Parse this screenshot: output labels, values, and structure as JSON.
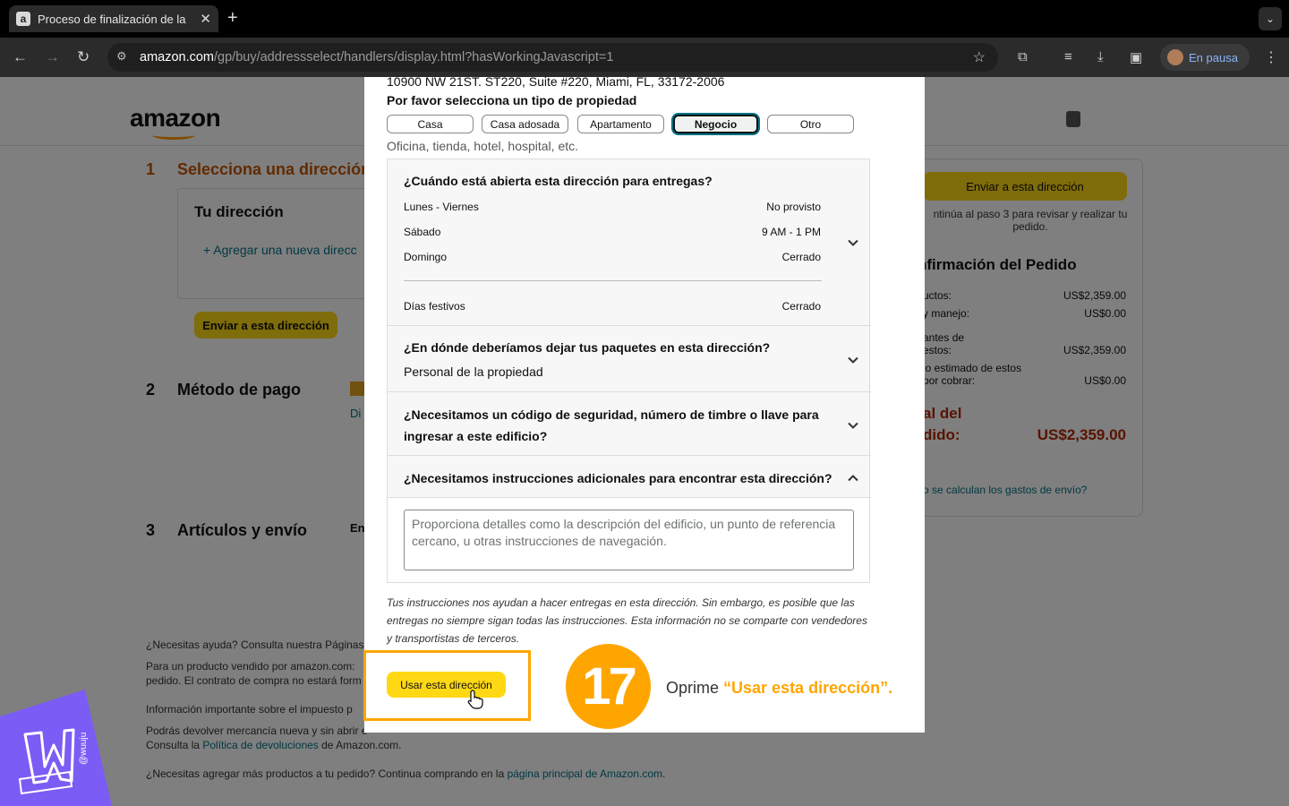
{
  "browser": {
    "tab_title": "Proceso de finalización de la",
    "favicon_letter": "a",
    "url_domain": "amazon.com",
    "url_path": "/gp/buy/addressselect/handlers/display.html?hasWorkingJavascript=1",
    "profile_label": "En pausa"
  },
  "page": {
    "logo": "amazon",
    "step1_num": "1",
    "step1_title": "Selecciona una dirección",
    "your_address": "Tu dirección",
    "add_address": "+ Agregar una nueva direcc",
    "ship_here": "Enviar a esta dirección",
    "step2_num": "2",
    "step2_title": "Método de pago",
    "step2_link": "Di",
    "step3_num": "3",
    "step3_title": "Artículos y envío",
    "step3_text": "En",
    "summary": {
      "ship_button": "Enviar a esta dirección",
      "continue_note": "ntinúa al paso 3 para revisar y realizar tu pedido.",
      "title": "nfirmación del Pedido",
      "rows": [
        {
          "label": "uctos:",
          "value": "US$2,359.00"
        },
        {
          "label": "y manejo:",
          "value": "US$0.00"
        },
        {
          "label": "antes de estos:",
          "value": "US$2,359.00"
        },
        {
          "label": "lo estimado de estos por cobrar:",
          "value": "US$0.00"
        }
      ],
      "total_label_1": "al del",
      "total_label_2": "dido:",
      "total_value": "US$2,359.00",
      "shipping_link": "o se calculan los gastos de envío?"
    },
    "footer": {
      "help": "¿Necesitas ayuda? Consulta nuestra Páginas",
      "line1": "Para un producto vendido por amazon.com:",
      "line2": "pedido. El contrato de compra no estará form",
      "tax_info": "Información importante sobre el impuesto p",
      "returns1": "Podrás devolver mercancía nueva y sin abrir e",
      "returns2_pre": "Consulta la ",
      "returns2_link": "Política de devoluciones",
      "returns2_post": " de Amazon.com.",
      "more_pre": "¿Necesitas agregar más productos a tu pedido? Continua comprando en la ",
      "more_link": "página principal de Amazon.com",
      "more_post": "."
    }
  },
  "modal": {
    "address_line": "10900 NW 21ST. ST220, Suite #220, Miami, FL, 33172-2006",
    "property_prompt": "Por favor selecciona un tipo de propiedad",
    "property_types": [
      "Casa",
      "Casa adosada",
      "Apartamento",
      "Negocio",
      "Otro"
    ],
    "selected_property": "Negocio",
    "property_desc": "Oficina, tienda, hotel, hospital, etc.",
    "hours_question": "¿Cuándo está abierta esta dirección para entregas?",
    "hours": [
      {
        "day": "Lunes - Viernes",
        "value": "No provisto"
      },
      {
        "day": "Sábado",
        "value": "9 AM - 1 PM"
      },
      {
        "day": "Domingo",
        "value": "Cerrado"
      },
      {
        "day": "Días festivos",
        "value": "Cerrado"
      }
    ],
    "packages_question": "¿En dónde deberíamos dejar tus paquetes en esta dirección?",
    "packages_answer": "Personal de la propiedad",
    "security_question": "¿Necesitamos un código de seguridad, número de timbre o llave para ingresar a este edificio?",
    "instructions_question": "¿Necesitamos instrucciones adicionales para encontrar esta dirección?",
    "instructions_placeholder": "Proporciona detalles como la descripción del edificio, un punto de referencia cercano, u otras instrucciones de navegación.",
    "disclaimer": "Tus instrucciones nos ayudan a hacer entregas en esta dirección. Sin embargo, es posible que las entregas no siempre sigan todas las instrucciones. Esta información no se comparte con vendedores y transportistas de terceros.",
    "use_address_button": "Usar esta dirección"
  },
  "callout": {
    "step_number": "17",
    "text_prefix": "Oprime ",
    "text_highlight": "“Usar esta dirección”."
  },
  "colors": {
    "amazon_yellow": "#ffd814",
    "highlight_orange": "#ffa500",
    "selected_teal": "#007185",
    "watermark_purple": "#7b5cf5"
  }
}
